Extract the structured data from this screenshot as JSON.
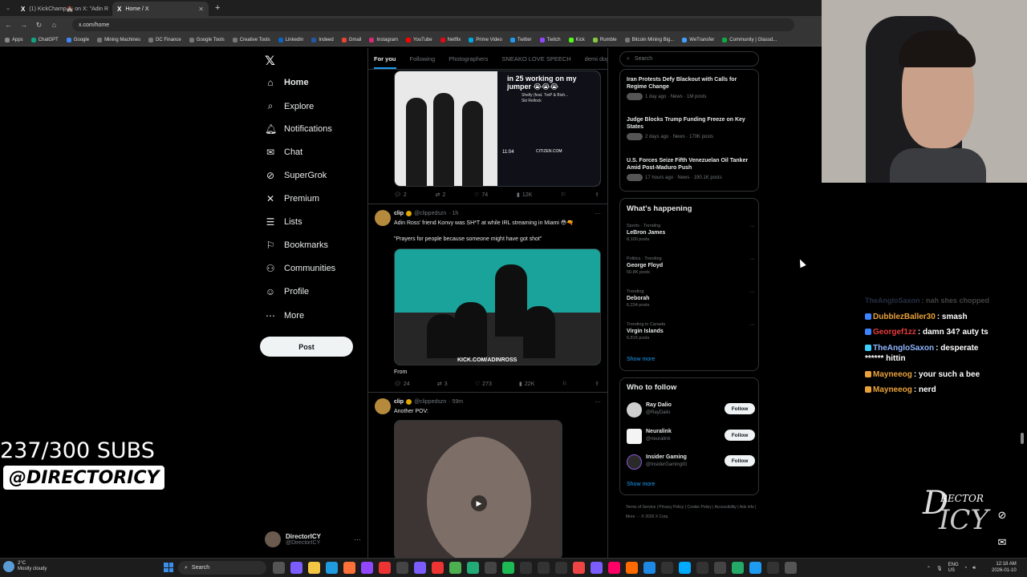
{
  "browser": {
    "tabs": [
      {
        "label": "(1) KickChamp🏰 on X: \"Adin R",
        "active": false
      },
      {
        "label": "Home / X",
        "active": true
      }
    ],
    "url": "x.com/home",
    "bookmarks": [
      "Apps",
      "ChatGPT",
      "Google",
      "Mining Machines",
      "DC Finance",
      "Google Tools",
      "Creative Tools",
      "LinkedIn",
      "Indeed",
      "Gmail",
      "Instagram",
      "YouTube",
      "Netflix",
      "Prime Video",
      "Twitter",
      "Twitch",
      "Kick",
      "Rumble",
      "Bitcoin Mining Big...",
      "WeTransfer",
      "Community | Glassd..."
    ]
  },
  "nav": {
    "items": [
      {
        "label": "Home",
        "icon": "home-icon",
        "active": true
      },
      {
        "label": "Explore",
        "icon": "search-icon"
      },
      {
        "label": "Notifications",
        "icon": "bell-icon"
      },
      {
        "label": "Chat",
        "icon": "mail-icon"
      },
      {
        "label": "SuperGrok",
        "icon": "grok-icon"
      },
      {
        "label": "Premium",
        "icon": "x-icon"
      },
      {
        "label": "Lists",
        "icon": "list-icon"
      },
      {
        "label": "Bookmarks",
        "icon": "bookmark-icon"
      },
      {
        "label": "Communities",
        "icon": "people-icon"
      },
      {
        "label": "Profile",
        "icon": "user-icon"
      },
      {
        "label": "More",
        "icon": "more-icon"
      }
    ],
    "post_label": "Post",
    "account": {
      "name": "DirectorICY",
      "handle": "@DirectorICY"
    }
  },
  "feed": {
    "tabs": [
      "For you",
      "Following",
      "Photographers",
      "SNEAKO LOVE SPEECH",
      "demi dog"
    ],
    "tweet1": {
      "media_text": "in 25 working on my jumper 😭😭😭",
      "song": "Shelly (feat. TreP & Bish...",
      "song_artist": "Ski Rellock",
      "time": "11:04",
      "brand": "CITIZEN.COM",
      "stats": {
        "replies": "2",
        "reposts": "2",
        "likes": "74",
        "views": "12K"
      }
    },
    "tweet2": {
      "name": "clip",
      "handle": "@clippedszn",
      "time": "· 1h",
      "text": "Adin Ross' friend Konvy was SH*T at while IRL streaming in Miami 😳🔫",
      "quote": "\"Prayers for people because someone might have got shot\"",
      "media_overlay": "KICK.COM/ADINROSS",
      "from": "From",
      "stats": {
        "replies": "24",
        "reposts": "3",
        "likes": "273",
        "views": "22K"
      }
    },
    "tweet3": {
      "name": "clip",
      "handle": "@clippedszn",
      "time": "· 59m",
      "text": "Another POV:"
    }
  },
  "right": {
    "search_placeholder": "Search",
    "news": [
      {
        "title": "Iran Protests Defy Blackout with Calls for Regime Change",
        "meta": "1 day ago · News · 1M posts"
      },
      {
        "title": "Judge Blocks Trump Funding Freeze on Key States",
        "meta": "2 days ago · News · 170K posts"
      },
      {
        "title": "U.S. Forces Seize Fifth Venezuelan Oil Tanker Amid Post-Maduro Push",
        "meta": "17 hours ago · News · 190.1K posts"
      }
    ],
    "happening_title": "What's happening",
    "trends": [
      {
        "category": "Sports · Trending",
        "name": "LeBron James",
        "count": "8,100 posts"
      },
      {
        "category": "Politics · Trending",
        "name": "George Floyd",
        "count": "50.8K posts"
      },
      {
        "category": "Trending",
        "name": "Deborah",
        "count": "6,234 posts"
      },
      {
        "category": "Trending in Canada",
        "name": "Virgin Islands",
        "count": "6,815 posts"
      }
    ],
    "show_more": "Show more",
    "who_to_follow_title": "Who to follow",
    "follow": [
      {
        "name": "Ray Dalio",
        "handle": "@RayDalio"
      },
      {
        "name": "Neuralink",
        "handle": "@neuralink"
      },
      {
        "name": "Insider Gaming",
        "handle": "@InsiderGamingIG"
      }
    ],
    "follow_label": "Follow",
    "footer": "Terms of Service | Privacy Policy | Cookie Policy | Accessibility | Ads info | More ··· © 2026 X Corp."
  },
  "overlay": {
    "subs": "237/300 SUBS",
    "handle": "@DIRECTORICY",
    "chat": [
      {
        "user": "TheAngloSaxon",
        "text": ": nah shes chopped",
        "color": "#8fb7ff",
        "faded": true
      },
      {
        "user": "DubblezBaller30",
        "text": ": smash",
        "color": "#e9a23b"
      },
      {
        "user": "Georgef1zz",
        "text": ": damn 34? auty ts",
        "color": "#e83b3b"
      },
      {
        "user": "TheAngloSaxon",
        "text": ": desperate",
        "color": "#8fb7ff"
      },
      {
        "user": "",
        "text": "****** hittin",
        "color": "#ffffff"
      },
      {
        "user": "Mayneeog",
        "text": ": your such a bee",
        "color": "#e9a23b"
      },
      {
        "user": "Mayneeog",
        "text": ": nerd",
        "color": "#e9a23b"
      }
    ],
    "logo_big": "D",
    "logo_small": "RECTOR",
    "logo_icy": "ICY"
  },
  "taskbar": {
    "weather_temp": "2°C",
    "weather_desc": "Mostly cloudy",
    "search": "Search",
    "lang": "ENG",
    "region": "US",
    "time": "12:18 AM",
    "date": "2026-01-10"
  }
}
